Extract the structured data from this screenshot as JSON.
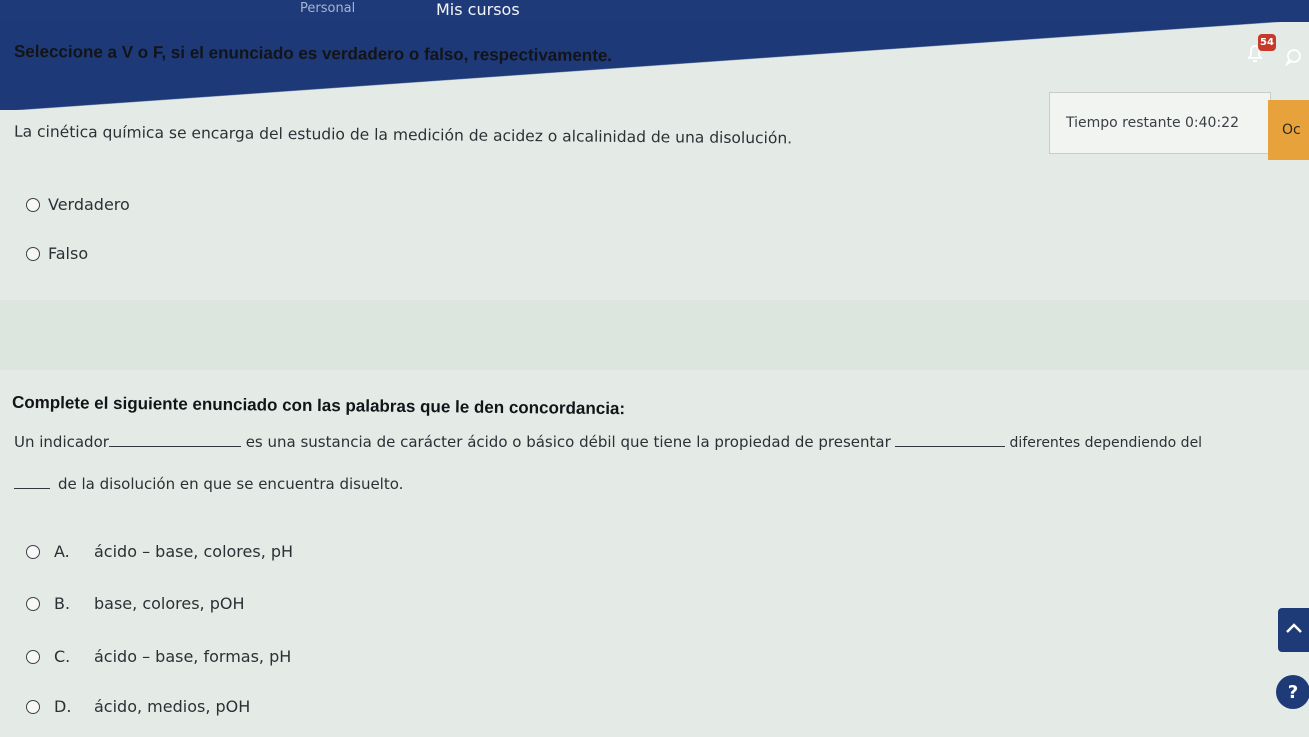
{
  "header": {
    "breadcrumb_prev": "Personal",
    "courses_link": "Mis cursos",
    "notification_count": "54"
  },
  "question1": {
    "instruction": "Seleccione a V o F, si el enunciado es verdadero o falso, respectivamente.",
    "statement": "La cinética química se encarga del estudio de la medición de acidez o alcalinidad de una disolución.",
    "options": [
      "Verdadero",
      "Falso"
    ]
  },
  "timer": {
    "label": "Tiempo restante 0:40:22",
    "button_label": "Oc"
  },
  "question2": {
    "instruction": "Complete el siguiente enunciado con las palabras que le den concordancia:",
    "part1": "Un indicador",
    "part2": "es una sustancia de carácter ácido o básico débil que tiene la propiedad de presentar",
    "part3": "diferentes dependiendo del",
    "part4": "de la disolución en que se encuentra disuelto.",
    "options": [
      {
        "letter": "A.",
        "text": "ácido – base, colores, pH"
      },
      {
        "letter": "B.",
        "text": "base, colores, pOH"
      },
      {
        "letter": "C.",
        "text": "ácido – base, formas, pH"
      },
      {
        "letter": "D.",
        "text": "ácido, medios, pOH"
      }
    ]
  },
  "help": {
    "label": "?"
  }
}
